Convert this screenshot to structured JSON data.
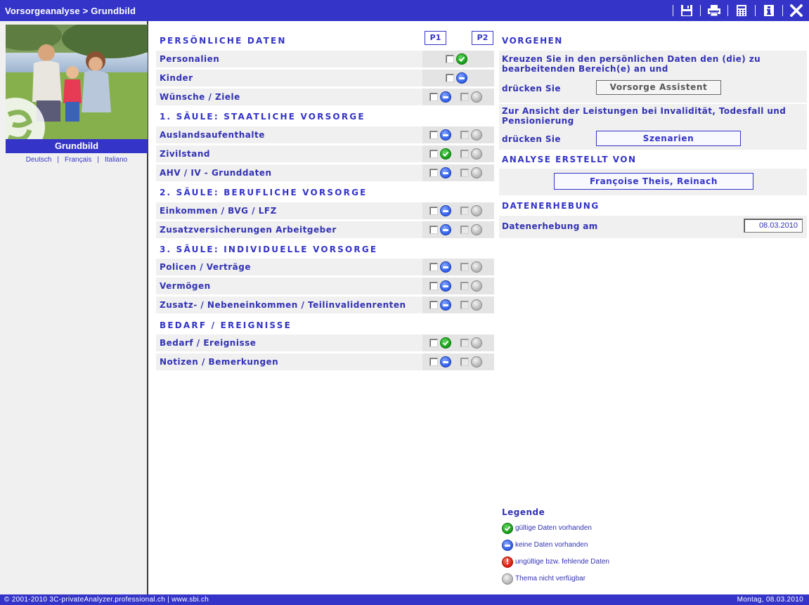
{
  "window": {
    "title": "Vorsorgeanalyse > Grundbild",
    "toolbar": [
      "save-icon",
      "print-icon",
      "calculator-icon",
      "info-icon",
      "close-icon"
    ]
  },
  "sidebar": {
    "caption": "Grundbild",
    "languages": [
      "Deutsch",
      "Français",
      "Italiano"
    ]
  },
  "columns": {
    "p1": "P1",
    "p2": "P2"
  },
  "sections": [
    {
      "title": "PERSÖNLICHE DATEN",
      "rows": [
        {
          "label": "Personalien",
          "p1": "ok",
          "p2": null
        },
        {
          "label": "Kinder",
          "p1": "none",
          "p2": null
        },
        {
          "label": "Wünsche / Ziele",
          "p1": "none",
          "p2": "na"
        }
      ]
    },
    {
      "title": "1. SÄULE: STAATLICHE VORSORGE",
      "rows": [
        {
          "label": "Auslandsaufenthalte",
          "p1": "none",
          "p2": "na"
        },
        {
          "label": "Zivilstand",
          "p1": "ok",
          "p2": "na"
        },
        {
          "label": "AHV / IV - Grunddaten",
          "p1": "none",
          "p2": "na"
        }
      ]
    },
    {
      "title": "2. SÄULE: BERUFLICHE VORSORGE",
      "rows": [
        {
          "label": "Einkommen / BVG / LFZ",
          "p1": "none",
          "p2": "na"
        },
        {
          "label": "Zusatzversicherungen Arbeitgeber",
          "p1": "none",
          "p2": "na"
        }
      ]
    },
    {
      "title": "3. SÄULE: INDIVIDUELLE VORSORGE",
      "rows": [
        {
          "label": "Policen / Verträge",
          "p1": "none",
          "p2": "na"
        },
        {
          "label": "Vermögen",
          "p1": "none",
          "p2": "na"
        },
        {
          "label": "Zusatz- / Nebeneinkommen / Teilinvalidenrenten",
          "p1": "none",
          "p2": "na"
        }
      ]
    },
    {
      "title": "BEDARF / EREIGNISSE",
      "rows": [
        {
          "label": "Bedarf / Ereignisse",
          "p1": "ok",
          "p2": "na"
        },
        {
          "label": "Notizen / Bemerkungen",
          "p1": "none",
          "p2": "na"
        }
      ]
    }
  ],
  "vorgehen": {
    "title": "VORGEHEN",
    "text1": "Kreuzen Sie in den persönlichen Daten den (die) zu bearbeitenden Bereich(e) an und",
    "druecken1": "drücken Sie",
    "btn_assistent": "Vorsorge Assistent",
    "text2": "Zur Ansicht der Leistungen bei Invalidität, Todesfall und Pensionierung",
    "druecken2": "drücken Sie",
    "btn_szenarien": "Szenarien"
  },
  "analyse": {
    "title": "ANALYSE ERSTELLT VON",
    "author": "Françoise Theis, Reinach"
  },
  "datenerhebung": {
    "title": "DATENERHEBUNG",
    "label": "Datenerhebung am",
    "value": "08.03.2010"
  },
  "legend": {
    "title": "Legende",
    "items": [
      {
        "status": "ok",
        "text": "gültige Daten vorhanden"
      },
      {
        "status": "none",
        "text": "keine Daten vorhanden"
      },
      {
        "status": "err",
        "text": "ungültige bzw. fehlende Daten"
      },
      {
        "status": "na",
        "text": "Thema nicht verfügbar"
      }
    ]
  },
  "footer": {
    "copyright": "© 2001-2010 3C-privateAnalyzer.professional.ch | www.sbi.ch",
    "date": "Montag, 08.03.2010"
  },
  "colors": {
    "brand": "#3434c8",
    "panel": "#f0f0f0",
    "ok": "#149a14",
    "none": "#2d5ce8",
    "err": "#d21a0a",
    "na": "#b2b2b2"
  }
}
